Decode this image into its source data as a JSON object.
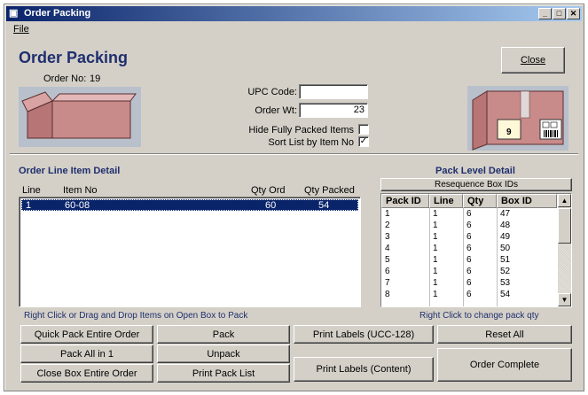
{
  "window": {
    "title": "Order Packing",
    "min_label": "_",
    "max_label": "□",
    "close_label": "✕"
  },
  "menu": {
    "file": "File"
  },
  "header": {
    "title": "Order Packing",
    "order_no_label": "Order No:",
    "order_no_value": "19"
  },
  "close_button": "Close",
  "form": {
    "upc_label": "UPC Code:",
    "upc_value": "",
    "order_wt_label": "Order Wt:",
    "order_wt_value": "23",
    "hide_packed_label": "Hide Fully Packed Items",
    "hide_packed_checked": false,
    "sort_label": "Sort List by Item No",
    "sort_checked": true
  },
  "closed_box": {
    "box_number": "9"
  },
  "line_items": {
    "title": "Order Line Item Detail",
    "columns": [
      "Line",
      "Item No",
      "Qty Ord",
      "Qty Packed"
    ],
    "rows": [
      {
        "line": "1",
        "item_no": "60-08",
        "qty_ord": "60",
        "qty_packed": "54"
      }
    ],
    "hint": "Right Click or Drag and Drop Items on Open Box to Pack"
  },
  "pack_level": {
    "title": "Pack Level Detail",
    "resequence_label": "Resequence Box IDs",
    "columns": [
      "Pack ID",
      "Line",
      "Qty",
      "Box ID"
    ],
    "rows": [
      [
        "1",
        "1",
        "6",
        "47"
      ],
      [
        "2",
        "1",
        "6",
        "48"
      ],
      [
        "3",
        "1",
        "6",
        "49"
      ],
      [
        "4",
        "1",
        "6",
        "50"
      ],
      [
        "5",
        "1",
        "6",
        "51"
      ],
      [
        "6",
        "1",
        "6",
        "52"
      ],
      [
        "7",
        "1",
        "6",
        "53"
      ],
      [
        "8",
        "1",
        "6",
        "54"
      ]
    ],
    "hint": "Right Click to change pack qty"
  },
  "buttons": {
    "quick_pack": "Quick Pack Entire Order",
    "pack_all_in_1": "Pack All in 1",
    "close_box": "Close Box Entire Order",
    "pack": "Pack",
    "unpack": "Unpack",
    "print_pack_list": "Print Pack List",
    "print_labels_ucc": "Print Labels (UCC-128)",
    "print_labels_content": "Print Labels (Content)",
    "reset_all": "Reset All",
    "order_complete": "Order Complete"
  },
  "colors": {
    "title_blue": "#1f2f6e",
    "box_pink": "#c98a8a",
    "selection": "#0a246a"
  }
}
